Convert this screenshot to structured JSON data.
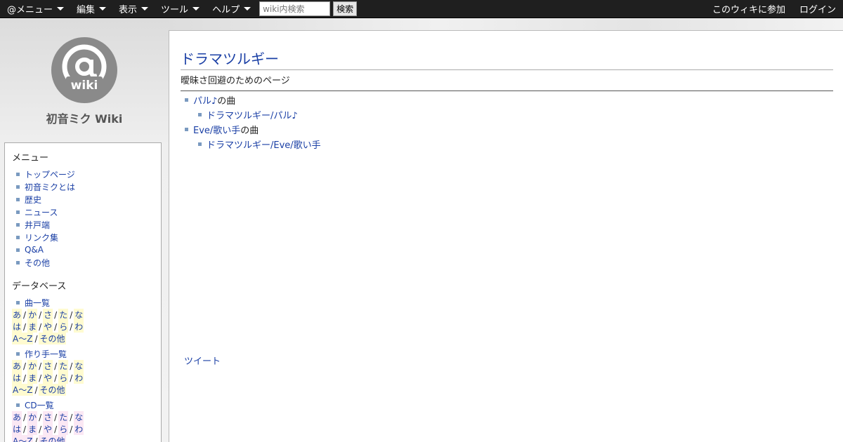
{
  "topbar": {
    "menus": [
      "@メニュー",
      "編集",
      "表示",
      "ツール",
      "ヘルプ"
    ],
    "search_placeholder": "wiki内検索",
    "search_button": "検索",
    "join_label": "このウィキに参加",
    "login_label": "ログイン"
  },
  "site": {
    "logo_text": "wiki",
    "title": "初音ミク Wiki"
  },
  "sidebar": {
    "menu_heading": "メニュー",
    "menu_items": [
      "トップページ",
      "初音ミクとは",
      "歴史",
      "ニュース",
      "井戸端",
      "リンク集",
      "Q&A",
      "その他"
    ],
    "db_heading": "データベース",
    "db_blocks": [
      {
        "title": "曲一覧",
        "row1": [
          "あ",
          "か",
          "さ",
          "た",
          "な"
        ],
        "row2": [
          "は",
          "ま",
          "や",
          "ら",
          "わ"
        ],
        "row3": [
          "A～Z",
          "その他"
        ]
      },
      {
        "title": "作り手一覧",
        "row1": [
          "あ",
          "か",
          "さ",
          "た",
          "な"
        ],
        "row2": [
          "は",
          "ま",
          "や",
          "ら",
          "わ"
        ],
        "row3": [
          "A～Z",
          "その他"
        ]
      },
      {
        "title": "CD一覧",
        "row1": [
          "あ",
          "か",
          "さ",
          "た",
          "な"
        ],
        "row2": [
          "は",
          "ま",
          "や",
          "ら",
          "わ"
        ],
        "row3": [
          "A～Z",
          "その他"
        ]
      }
    ]
  },
  "main": {
    "title": "ドラマツルギー",
    "subtitle": "曖昧さ回避のためのページ",
    "entries": [
      {
        "artist_link": "パル♪",
        "suffix": "の曲",
        "song_link": "ドラマツルギー/パル♪"
      },
      {
        "artist_link": "Eve/歌い手",
        "suffix": "の曲",
        "song_link": "ドラマツルギー/Eve/歌い手"
      }
    ],
    "tweet_label": "ツイート"
  },
  "colors": {
    "link": "#1a3fa5",
    "topbar_bg": "#1f1f1f",
    "bullet": "#7a9ac0",
    "highlight_yellow": "#fffbd0",
    "highlight_pink": "#fbe8f4"
  }
}
